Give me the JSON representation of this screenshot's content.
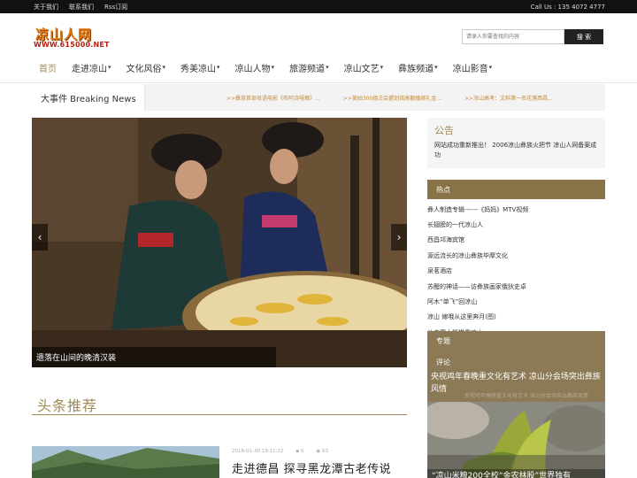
{
  "topbar": {
    "links": [
      "关于我们",
      "联系我们",
      "Rss订阅"
    ],
    "callus": "Call Us : 135 4072 4777"
  },
  "logo": {
    "name": "凉山人网",
    "url": "WWW.615000.NET"
  },
  "search": {
    "placeholder": "请录入你要查找的内容",
    "button": "搜 索"
  },
  "nav": {
    "items": [
      {
        "label": "首页",
        "dropdown": false,
        "active": true
      },
      {
        "label": "走进凉山",
        "dropdown": true
      },
      {
        "label": "文化风俗",
        "dropdown": true
      },
      {
        "label": "秀美凉山",
        "dropdown": true
      },
      {
        "label": "凉山人物",
        "dropdown": true
      },
      {
        "label": "旅游频道",
        "dropdown": true
      },
      {
        "label": "凉山文艺",
        "dropdown": true
      },
      {
        "label": "彝族频道",
        "dropdown": true
      },
      {
        "label": "凉山影音",
        "dropdown": true
      }
    ]
  },
  "breaking": {
    "label": "大事件 Breaking News",
    "items": [
      ">>彝族首部母语电影《布阿诗嘎薇》...",
      ">>美姑300德古会盟划指高额婚嫁礼金...",
      ">>凉山高考：文科第一名花落西昌..."
    ]
  },
  "slider": {
    "caption": "遗落在山间的晚清汉装",
    "prev": "‹",
    "next": "›"
  },
  "headline": {
    "title": "头条推荐",
    "article": {
      "date": "2018-01-30 19:11:22",
      "comments": "0",
      "views": "63",
      "title": "走进德昌 探寻黑龙潭古老传说"
    }
  },
  "notice": {
    "title": "公告",
    "text": "网站成功重新推出！ 2006凉山彝族火把节 凉山人网备案成功"
  },
  "hot": {
    "header": "热点",
    "items": [
      "彝人制造专辑------《妈妈》MTV视频",
      "长翅膀的一代凉山人",
      "西昌邛海宾馆",
      "源远流长的凉山彝族毕摩文化",
      "泉茗酒店",
      "苏醒的神话——访彝族画家俄狄史卓",
      "阿木“单飞”回凉山",
      "凉山 嫁哦从这里奔月(图)",
      "从中国大熊猫看凉山..."
    ]
  },
  "special": {
    "tab1": "专题",
    "tab2": "评论",
    "title": "央视鸡年春晚重文化有艺术 凉山分会场突出彝族风情",
    "faint": "央视鸡年春晚重文化有艺术 凉山分会场突出彝族风情"
  },
  "photo2": {
    "caption": "“凉山米粮200全校“金农林股”世界独有"
  },
  "colors": {
    "accent": "#a08a55",
    "hot_header": "#877346",
    "topbar": "#111111"
  }
}
